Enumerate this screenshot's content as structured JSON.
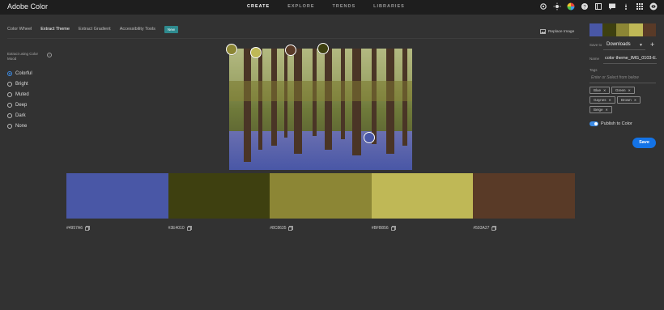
{
  "app": {
    "title": "Adobe Color"
  },
  "topnav": [
    "CREATE",
    "EXPLORE",
    "TRENDS",
    "LIBRARIES"
  ],
  "topnav_active": "CREATE",
  "subtabs": {
    "items": [
      "Color Wheel",
      "Extract Theme",
      "Extract Gradient",
      "Accessibility Tools"
    ],
    "active": "Extract Theme",
    "new_badge": "New"
  },
  "replace_image": "Replace Image",
  "extract": {
    "label": "Extract using Color Mood",
    "moods": [
      "Colorful",
      "Bright",
      "Muted",
      "Deep",
      "Dark",
      "None"
    ],
    "selected": "Colorful"
  },
  "swatches": [
    {
      "hex": "#4957A6",
      "color": "#4957A6"
    },
    {
      "hex": "#3E4010",
      "color": "#3E4010"
    },
    {
      "hex": "#8C8635",
      "color": "#8C8635"
    },
    {
      "hex": "#BFB856",
      "color": "#BFB856"
    },
    {
      "hex": "#593A27",
      "color": "#593A27"
    }
  ],
  "right_panel": {
    "save_to_label": "Save to",
    "save_to_value": "Downloads",
    "name_label": "Name",
    "name_value": "color theme_IMG_0103-E...",
    "tags_label": "Tags",
    "tags_placeholder": "Enter or Select from below",
    "tags": [
      "Blue",
      "Green",
      "Gaynes",
      "Brown",
      "Beige"
    ],
    "publish_label": "Publish to Color",
    "publish_on": true,
    "save_button": "Save"
  },
  "colors": {
    "accent": "#1473E6",
    "badge": "#2E8A8E",
    "background": "#323232",
    "topbar": "#1E1E1E"
  }
}
